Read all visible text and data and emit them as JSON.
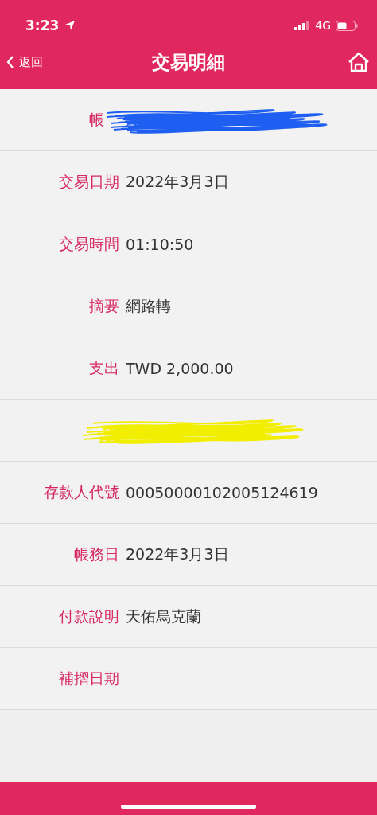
{
  "status_bar": {
    "time": "3:23",
    "network": "4G"
  },
  "nav": {
    "back": "返回",
    "title": "交易明細"
  },
  "rows": [
    {
      "kind": "scribbled",
      "label": "帳",
      "color": "#1e5ef0"
    },
    {
      "kind": "text",
      "label": "交易日期",
      "value": "2022年3月3日"
    },
    {
      "kind": "text",
      "label": "交易時間",
      "value": "01:10:50"
    },
    {
      "kind": "text",
      "label": "摘要",
      "value": "網路轉"
    },
    {
      "kind": "text",
      "label": "支出",
      "value": "TWD 2,000.00"
    },
    {
      "kind": "scribbled",
      "color": "#f2ee00"
    },
    {
      "kind": "text",
      "label": "存款人代號",
      "value": "00050000102005124619"
    },
    {
      "kind": "text",
      "label": "帳務日",
      "value": "2022年3月3日"
    },
    {
      "kind": "text",
      "label": "付款說明",
      "value": "天佑烏克蘭"
    },
    {
      "kind": "text",
      "label": "補摺日期"
    }
  ]
}
